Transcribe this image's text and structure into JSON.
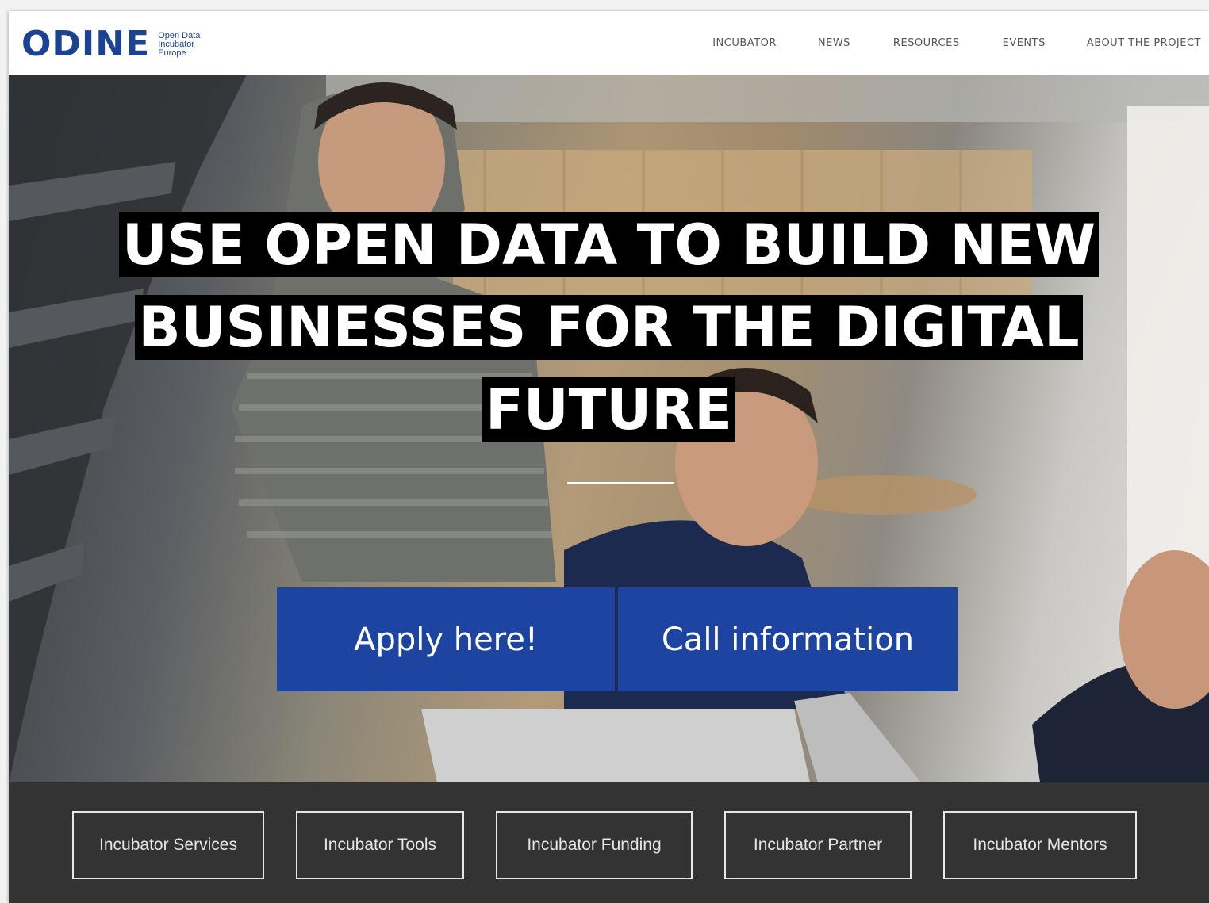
{
  "logo": {
    "word": "ODINE",
    "sub_line1": "Open Data",
    "sub_line2": "Incubator",
    "sub_line3": "Europe"
  },
  "nav": {
    "items": [
      "INCUBATOR",
      "NEWS",
      "RESOURCES",
      "EVENTS",
      "ABOUT THE PROJECT"
    ]
  },
  "hero": {
    "title_line1": "USE OPEN DATA TO BUILD NEW",
    "title_line2": "BUSINESSES FOR THE DIGITAL",
    "title_line3": "FUTURE",
    "apply_label": "Apply here!",
    "call_label": "Call information"
  },
  "services": {
    "items": [
      "Incubator Services",
      "Incubator Tools",
      "Incubator Funding",
      "Incubator Partner",
      "Incubator Mentors"
    ]
  },
  "colors": {
    "brand_blue": "#1c4393",
    "cta_blue": "#1d44a0",
    "band_dark": "#333333"
  }
}
